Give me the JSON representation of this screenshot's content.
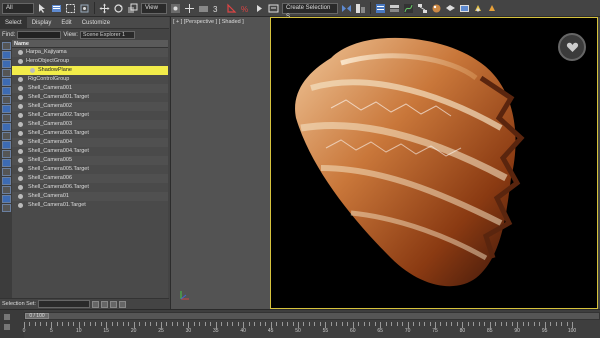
{
  "toolbar": {
    "filter_select": "All",
    "ref_coord_select": "View",
    "selection_set_select": "Create Selection S"
  },
  "menu": {
    "items": [
      "Select",
      "Display",
      "Edit",
      "Customize"
    ]
  },
  "find": {
    "label": "Find:",
    "view_label": "View:",
    "view_value": "Scene Explorer 1"
  },
  "scene": {
    "header": "Name",
    "rows": [
      {
        "label": "Harpa_Kajiyama",
        "indent": 1
      },
      {
        "label": "HeroObjectGroup",
        "indent": 1
      },
      {
        "label": "ShadowPlane",
        "indent": 2,
        "selected": true
      },
      {
        "label": "RigControlGroup",
        "indent": 0
      },
      {
        "label": "Shell_Camera001",
        "indent": 0
      },
      {
        "label": "Shell_Camera001.Target",
        "indent": 0
      },
      {
        "label": "Shell_Camera002",
        "indent": 0
      },
      {
        "label": "Shell_Camera002.Target",
        "indent": 0
      },
      {
        "label": "Shell_Camera003",
        "indent": 0
      },
      {
        "label": "Shell_Camera003.Target",
        "indent": 0
      },
      {
        "label": "Shell_Camera004",
        "indent": 0
      },
      {
        "label": "Shell_Camera004.Target",
        "indent": 0
      },
      {
        "label": "Shell_Camera005",
        "indent": 0
      },
      {
        "label": "Shell_Camera005.Target",
        "indent": 0
      },
      {
        "label": "Shell_Camera006",
        "indent": 0
      },
      {
        "label": "Shell_Camera006.Target",
        "indent": 0
      },
      {
        "label": "Shell_Camera01",
        "indent": 0
      },
      {
        "label": "Shell_Camera01.Target",
        "indent": 0
      }
    ]
  },
  "viewport": {
    "label": "[ + ] [Perspective ] [ Shaded ]"
  },
  "selection_set": {
    "label": "Selection Set:"
  },
  "timeline": {
    "frame_display": "0 / 100",
    "ticks": [
      "0",
      "5",
      "10",
      "15",
      "20",
      "25",
      "30",
      "35",
      "40",
      "45",
      "50",
      "55",
      "60",
      "65",
      "70",
      "75",
      "80",
      "85",
      "90",
      "95",
      "100"
    ]
  },
  "colors": {
    "selection_highlight": "#f2ec4a",
    "viewport_border": "#d6c23d"
  }
}
